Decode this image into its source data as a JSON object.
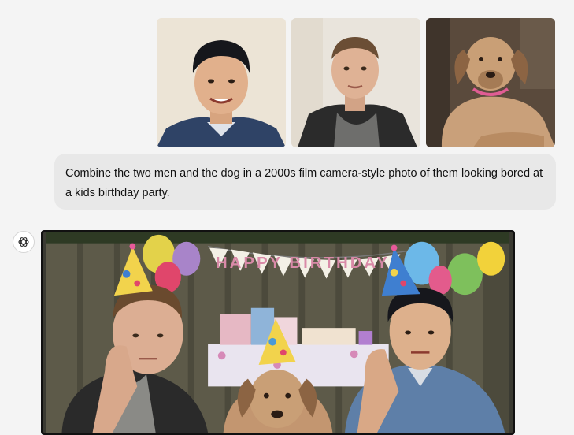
{
  "attachments": [
    {
      "name": "man-one-photo",
      "alt": ""
    },
    {
      "name": "man-two-photo",
      "alt": ""
    },
    {
      "name": "dog-photo",
      "alt": ""
    }
  ],
  "user_message": {
    "text": "Combine the two men and the dog in a 2000s film camera-style photo of them looking bored at a kids birthday party."
  },
  "assistant": {
    "icon": "openai-logo-icon",
    "image": {
      "banner_text": "HAPPY BIRTHDAY"
    }
  },
  "colors": {
    "page_background": "#f4f4f4",
    "bubble_background": "#e8e8e8",
    "text": "#111111"
  }
}
